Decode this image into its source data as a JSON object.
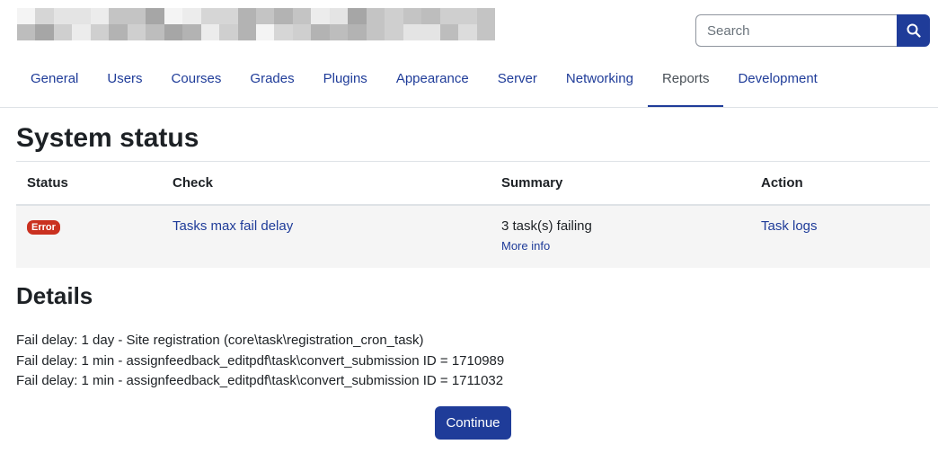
{
  "header": {
    "site_name_redacted": true
  },
  "search": {
    "placeholder": "Search",
    "value": "",
    "button_icon": "search-icon"
  },
  "tabs": [
    {
      "label": "General",
      "active": false
    },
    {
      "label": "Users",
      "active": false
    },
    {
      "label": "Courses",
      "active": false
    },
    {
      "label": "Grades",
      "active": false
    },
    {
      "label": "Plugins",
      "active": false
    },
    {
      "label": "Appearance",
      "active": false
    },
    {
      "label": "Server",
      "active": false
    },
    {
      "label": "Networking",
      "active": false
    },
    {
      "label": "Reports",
      "active": true
    },
    {
      "label": "Development",
      "active": false
    }
  ],
  "page_title": "System status",
  "table": {
    "headers": {
      "status": "Status",
      "check": "Check",
      "summary": "Summary",
      "action": "Action"
    },
    "rows": [
      {
        "status": "Error",
        "check": "Tasks max fail delay",
        "summary": "3 task(s) failing",
        "more_info": "More info",
        "action": "Task logs"
      }
    ]
  },
  "details": {
    "title": "Details",
    "lines": [
      "Fail delay: 1 day - Site registration (core\\task\\registration_cron_task)",
      "Fail delay: 1 min - assignfeedback_editpdf\\task\\convert_submission ID = 1710989",
      "Fail delay: 1 min - assignfeedback_editpdf\\task\\convert_submission ID = 1711032"
    ]
  },
  "continue_label": "Continue",
  "colors": {
    "primary": "#1f3c99",
    "error": "#ca3120",
    "text": "#1d2125",
    "row_bg": "#f5f5f5"
  }
}
